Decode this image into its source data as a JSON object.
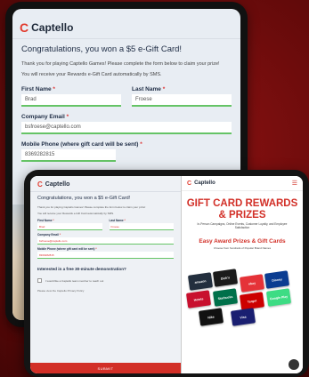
{
  "back_tablet": {
    "logo_text": "Captello",
    "title": "Congratulations, you won a $5 e-Gift Card!",
    "intro": "Thank you for playing Captello Games! Please complete the form below to claim your prize!",
    "sms_note": "You will receive your Rewards e-Gift Card automatically by SMS.",
    "first_name_label": "First Name",
    "first_name_value": "Brad",
    "last_name_label": "Last Name",
    "last_name_value": "Froese",
    "company_email_label": "Company Email",
    "company_email_value": "bsfroese@captello.com",
    "mobile_label": "Mobile Phone (where gift card will be sent)",
    "mobile_value": "8369282815"
  },
  "front_tablet": {
    "form": {
      "logo_text": "Captello",
      "title": "Congratulations, you won a $5 e-Gift Card!",
      "intro": "Thank you for playing Captello Games! Please complete the form below to claim your prize!",
      "sms_note": "You will receive your Rewards e-Gift Card automatically by SMS.",
      "first_name_label": "First Name",
      "first_name_value": "Brad",
      "last_name_label": "Last Name",
      "last_name_value": "Froese",
      "company_email_label": "Company Email",
      "company_email_value": "bsfroese@captello.com",
      "mobile_label": "Mobile Phone (where gift card will be sent)",
      "mobile_value": "8369282815",
      "question": "Interested in a free 30-minute demonstration?",
      "checkbox_label": "I would like a Captello team member to reach out",
      "privacy_note": "Please view the Captello Privacy Policy",
      "submit_label": "SUBMIT"
    },
    "promo": {
      "logo_text": "Captello",
      "hero_title": "GIFT CARD REWARDS & PRIZES",
      "hero_subtitle": "In-Person Campaigns, Online Events, Customer Loyalty, and Employee Satisfaction",
      "earn_title": "Easy Award Prizes & Gift Cards",
      "earn_subtitle": "Choose from hundreds of Popular Brand Names",
      "cards": [
        "amazon",
        "Dick's",
        "ebay",
        "Disney",
        "Hotels",
        "Starbucks",
        "Target",
        "Google Play",
        "Nike",
        "Visa"
      ]
    }
  },
  "colors": {
    "brand_red": "#d22f27",
    "accent_green": "#65c466",
    "background": "#7a0c0c"
  }
}
